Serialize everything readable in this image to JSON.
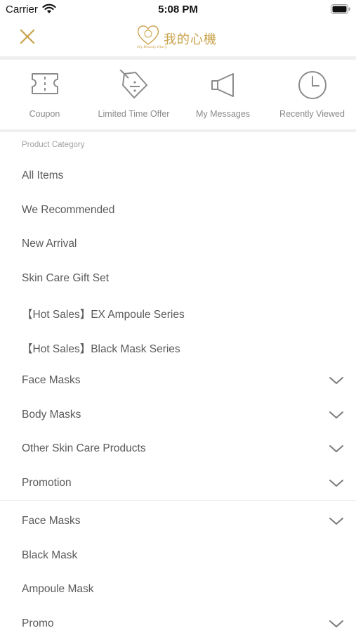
{
  "status_bar": {
    "carrier": "Carrier",
    "time": "5:08 PM"
  },
  "header": {
    "logo_text": "我的心機",
    "logo_subtext": "My Beauty Diary"
  },
  "quick_actions": [
    {
      "label": "Coupon",
      "icon": "ticket-icon"
    },
    {
      "label": "Limited Time Offer",
      "icon": "price-tag-icon"
    },
    {
      "label": "My Messages",
      "icon": "megaphone-icon"
    },
    {
      "label": "Recently Viewed",
      "icon": "clock-icon"
    }
  ],
  "category_section": {
    "title": "Product Category",
    "items": [
      {
        "label": "All Items",
        "expandable": false
      },
      {
        "label": "We Recommended",
        "expandable": false
      },
      {
        "label": "New Arrival",
        "expandable": false
      },
      {
        "label": "Skin Care Gift Set",
        "expandable": false
      },
      {
        "label": "【Hot Sales】EX Ampoule Series",
        "expandable": false
      },
      {
        "label": "【Hot Sales】Black Mask Series",
        "expandable": false
      },
      {
        "label": "Face Masks",
        "expandable": true
      },
      {
        "label": "Body Masks",
        "expandable": true
      },
      {
        "label": "Other Skin Care Products",
        "expandable": true
      },
      {
        "label": "Promotion",
        "expandable": true
      }
    ]
  },
  "second_section": {
    "items": [
      {
        "label": "Face Masks",
        "expandable": true
      },
      {
        "label": "Black Mask",
        "expandable": false
      },
      {
        "label": "Ampoule Mask",
        "expandable": false
      },
      {
        "label": "Promo",
        "expandable": true
      }
    ]
  },
  "colors": {
    "accent": "#c9a24a",
    "icon_gray": "#8c8c8c",
    "text": "#5a5a5a",
    "muted": "#a0a0a0"
  }
}
